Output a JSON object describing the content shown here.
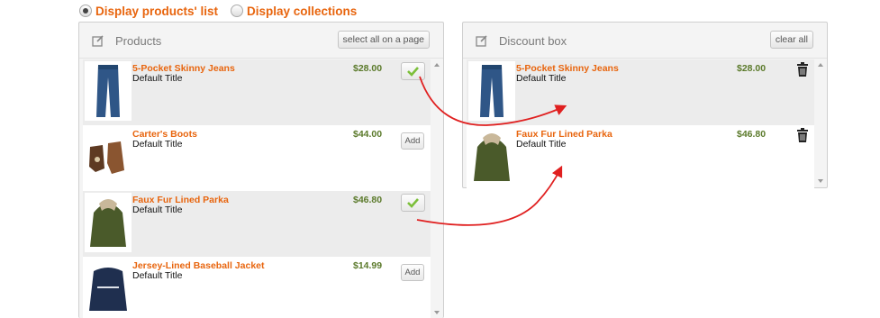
{
  "display_options": [
    {
      "label": "Display products' list",
      "selected": true
    },
    {
      "label": "Display collections",
      "selected": false
    }
  ],
  "products_panel": {
    "title": "Products",
    "select_all_label": "select all on a page",
    "items": [
      {
        "name": "5-Pocket Skinny Jeans",
        "variant": "Default Title",
        "price": "$28.00",
        "added": true,
        "image": "jeans"
      },
      {
        "name": "Carter's Boots",
        "variant": "Default Title",
        "price": "$44.00",
        "added": false,
        "button_label": "Add",
        "image": "boots"
      },
      {
        "name": "Faux Fur Lined Parka",
        "variant": "Default Title",
        "price": "$46.80",
        "added": true,
        "image": "parka"
      },
      {
        "name": "Jersey-Lined Baseball Jacket",
        "variant": "Default Title",
        "price": "$14.99",
        "added": false,
        "button_label": "Add",
        "image": "jacket"
      }
    ]
  },
  "discount_panel": {
    "title": "Discount box",
    "clear_all_label": "clear all",
    "items": [
      {
        "name": "5-Pocket Skinny Jeans",
        "variant": "Default Title",
        "price": "$28.00",
        "image": "jeans"
      },
      {
        "name": "Faux Fur Lined Parka",
        "variant": "Default Title",
        "price": "$46.80",
        "image": "parka"
      }
    ]
  },
  "colors": {
    "accent": "#e8650e",
    "price": "#5b7a2b",
    "annotation_arrow": "#e02020",
    "check": "#7cbf3a"
  }
}
